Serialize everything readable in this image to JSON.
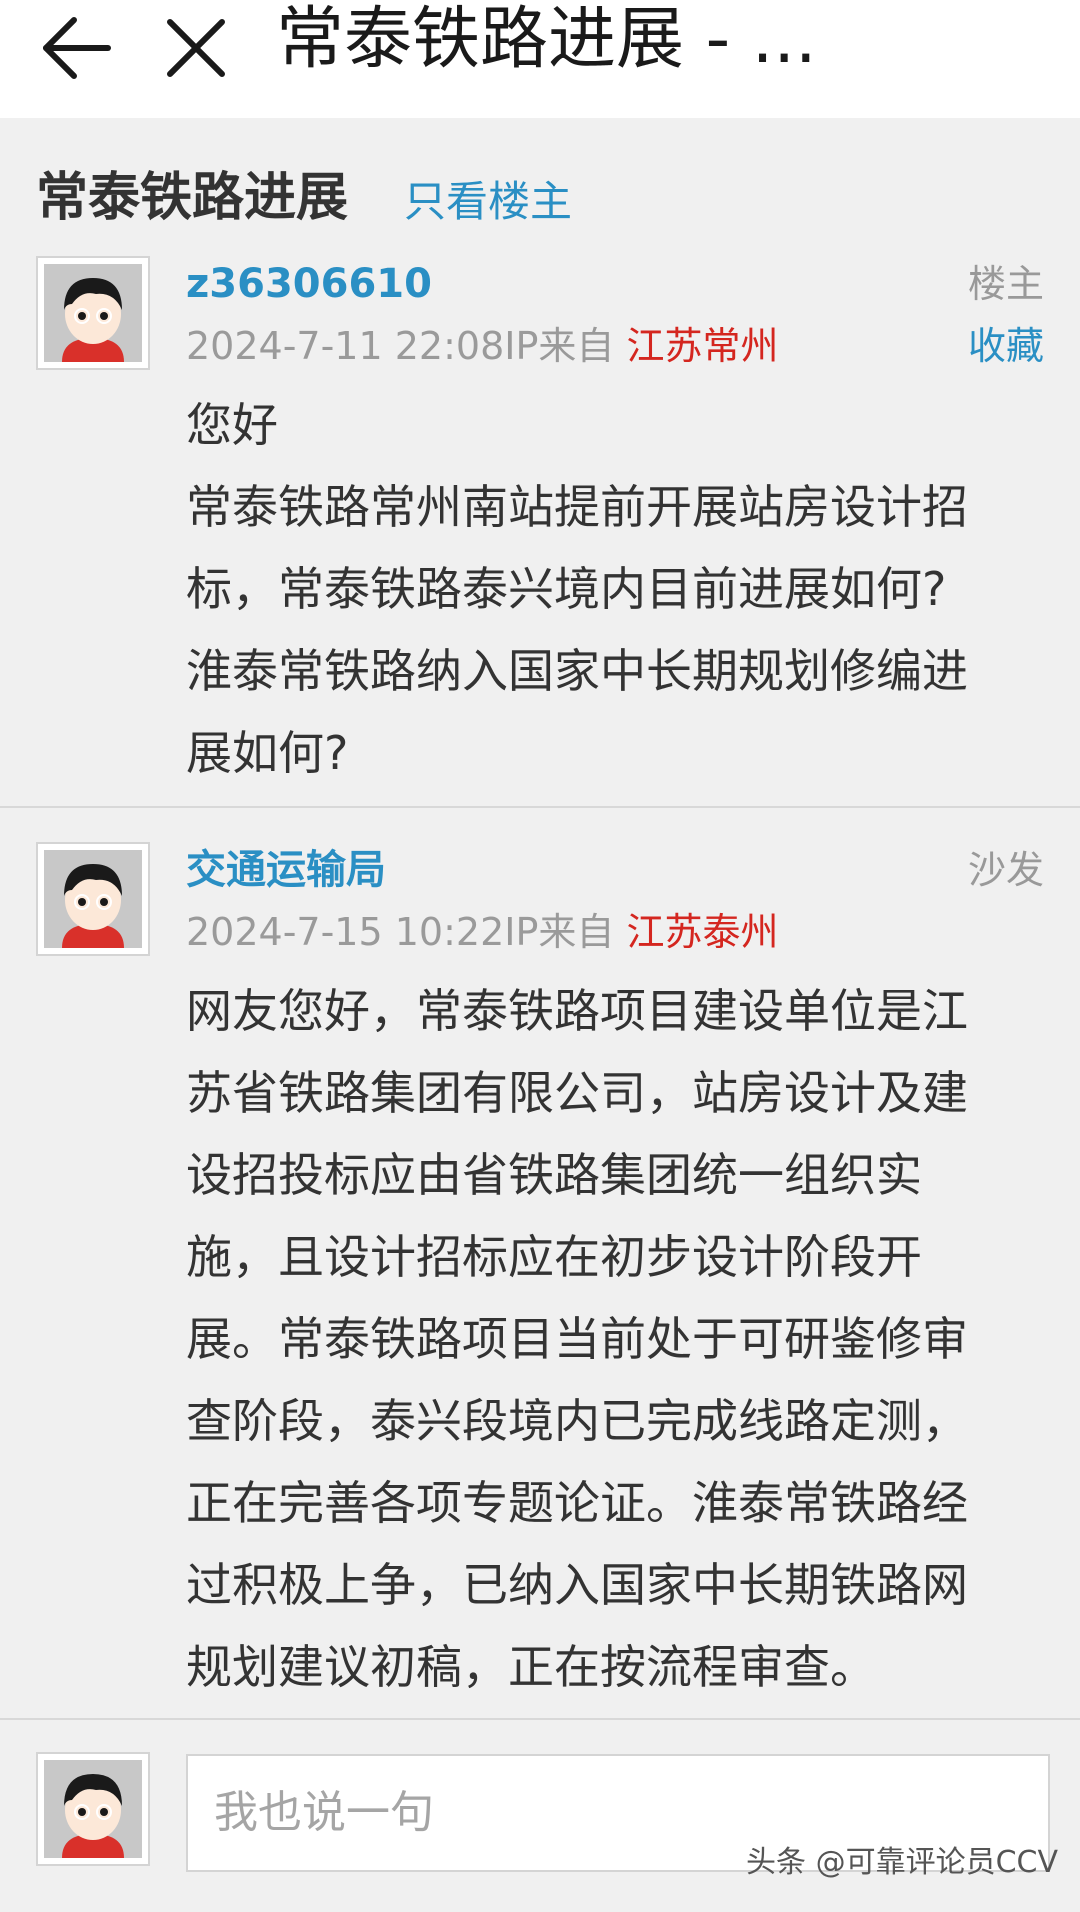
{
  "topbar": {
    "back_icon": "back-arrow-icon",
    "close_icon": "close-icon",
    "title": "常泰铁路进展 - ..."
  },
  "thread": {
    "title": "常泰铁路进展",
    "only_op_label": "只看楼主"
  },
  "posts": [
    {
      "username": "z36306610",
      "tag": "楼主",
      "favorite_label": "收藏",
      "time_ip": "2024-7-11 22:08IP来自 ",
      "location": "江苏常州",
      "lines": [
        "您好",
        "常泰铁路常州南站提前开展站房设计招",
        "标，常泰铁路泰兴境内目前进展如何?",
        "淮泰常铁路纳入国家中长期规划修编进",
        "展如何?"
      ]
    },
    {
      "username": "交通运输局",
      "tag": "沙发",
      "time_ip": "2024-7-15 10:22IP来自 ",
      "location": "江苏泰州",
      "lines": [
        "网友您好，常泰铁路项目建设单位是江",
        "苏省铁路集团有限公司，站房设计及建",
        "设招投标应由省铁路集团统一组织实",
        "施，且设计招标应在初步设计阶段开",
        "展。常泰铁路项目当前处于可研鉴修审",
        "查阶段，泰兴段境内已完成线路定测，",
        "正在完善各项专题论证。淮泰常铁路经",
        "过积极上争，已纳入国家中长期铁路网",
        "规划建议初稿，正在按流程审查。"
      ]
    }
  ],
  "reply": {
    "placeholder": "我也说一句"
  },
  "watermark": "头条 @可靠评论员CCV",
  "colors": {
    "link_blue": "#2a8fc4",
    "location_red": "#d4261f",
    "background": "#f0f0f0"
  }
}
